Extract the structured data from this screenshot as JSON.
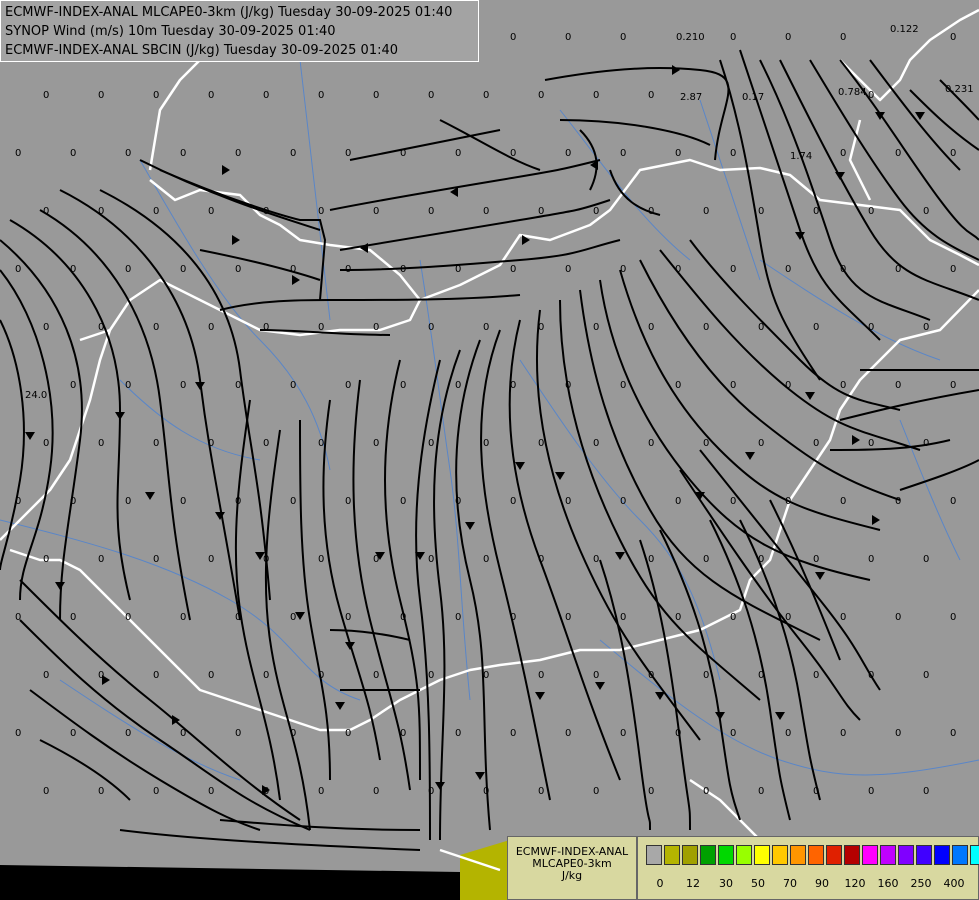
{
  "header": {
    "line1": "ECMWF-INDEX-ANAL MLCAPE0-3km (J/kg) Tuesday 30-09-2025 01:40",
    "line2": "SYNOP Wind (m/s) 10m Tuesday 30-09-2025 01:40",
    "line3": "ECMWF-INDEX-ANAL SBCIN (J/kg) Tuesday 30-09-2025 01:40"
  },
  "legend": {
    "title1": "ECMWF-INDEX-ANAL",
    "title2": "MLCAPE0-3km",
    "unit": "J/kg",
    "colors": [
      "#a8a8a8",
      "#b4b400",
      "#a0a000",
      "#00a000",
      "#00d800",
      "#98ff00",
      "#ffff00",
      "#ffc800",
      "#ff9600",
      "#ff6400",
      "#e02000",
      "#b40000",
      "#ff00ff",
      "#c000ff",
      "#8000ff",
      "#4000ff",
      "#0000ff",
      "#0078ff",
      "#00ffff",
      "#90ffff",
      "#ffffff"
    ],
    "ticks": [
      "0",
      "12",
      "30",
      "50",
      "70",
      "90",
      "120",
      "160",
      "250",
      "400"
    ]
  },
  "colors": {
    "map_background": "#999999",
    "border": "#ffffff",
    "river": "#5a86c8",
    "streamline": "#000000",
    "sea_highlight": "#b4b400"
  },
  "values_special": [
    "0.210",
    "0.122",
    "0.231",
    "2.87",
    "0.17",
    "0.784",
    "1.74",
    "24.0"
  ]
}
